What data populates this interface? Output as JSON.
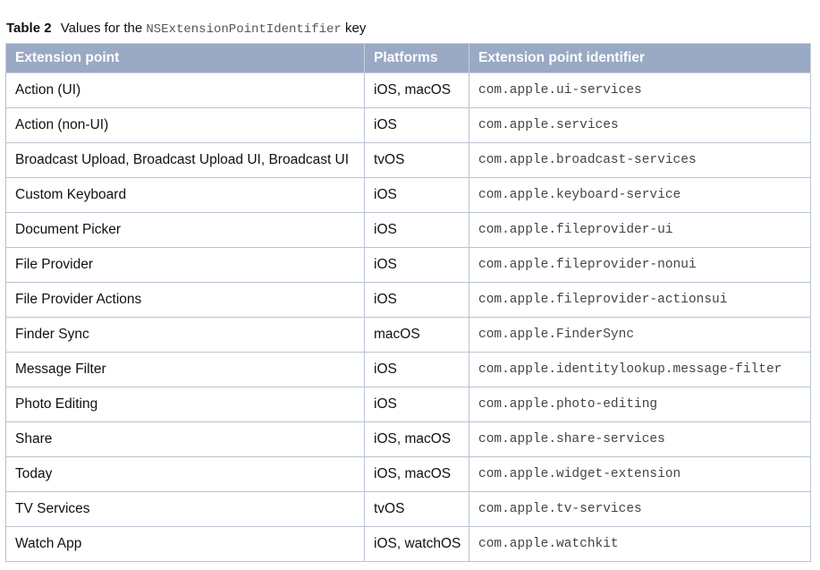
{
  "caption": {
    "label": "Table 2",
    "text_before": "Values for the",
    "code": "NSExtensionPointIdentifier",
    "text_after": "key"
  },
  "columns": [
    "Extension point",
    "Platforms",
    "Extension point identifier"
  ],
  "rows": [
    {
      "name": "Action (UI)",
      "platforms": "iOS, macOS",
      "identifier": "com.apple.ui-services"
    },
    {
      "name": "Action (non-UI)",
      "platforms": "iOS",
      "identifier": "com.apple.services"
    },
    {
      "name": "Broadcast Upload, Broadcast Upload UI, Broadcast UI",
      "platforms": "tvOS",
      "identifier": "com.apple.broadcast-services"
    },
    {
      "name": "Custom Keyboard",
      "platforms": "iOS",
      "identifier": "com.apple.keyboard-service"
    },
    {
      "name": "Document Picker",
      "platforms": "iOS",
      "identifier": "com.apple.fileprovider-ui"
    },
    {
      "name": "File Provider",
      "platforms": "iOS",
      "identifier": "com.apple.fileprovider-nonui"
    },
    {
      "name": "File Provider Actions",
      "platforms": "iOS",
      "identifier": "com.apple.fileprovider-actionsui"
    },
    {
      "name": "Finder Sync",
      "platforms": "macOS",
      "identifier": "com.apple.FinderSync"
    },
    {
      "name": "Message Filter",
      "platforms": "iOS",
      "identifier": "com.apple.identitylookup.message-filter"
    },
    {
      "name": "Photo Editing",
      "platforms": "iOS",
      "identifier": "com.apple.photo-editing"
    },
    {
      "name": "Share",
      "platforms": "iOS, macOS",
      "identifier": "com.apple.share-services"
    },
    {
      "name": "Today",
      "platforms": "iOS, macOS",
      "identifier": "com.apple.widget-extension"
    },
    {
      "name": "TV Services",
      "platforms": "tvOS",
      "identifier": "com.apple.tv-services"
    },
    {
      "name": "Watch App",
      "platforms": "iOS, watchOS",
      "identifier": "com.apple.watchkit"
    }
  ]
}
